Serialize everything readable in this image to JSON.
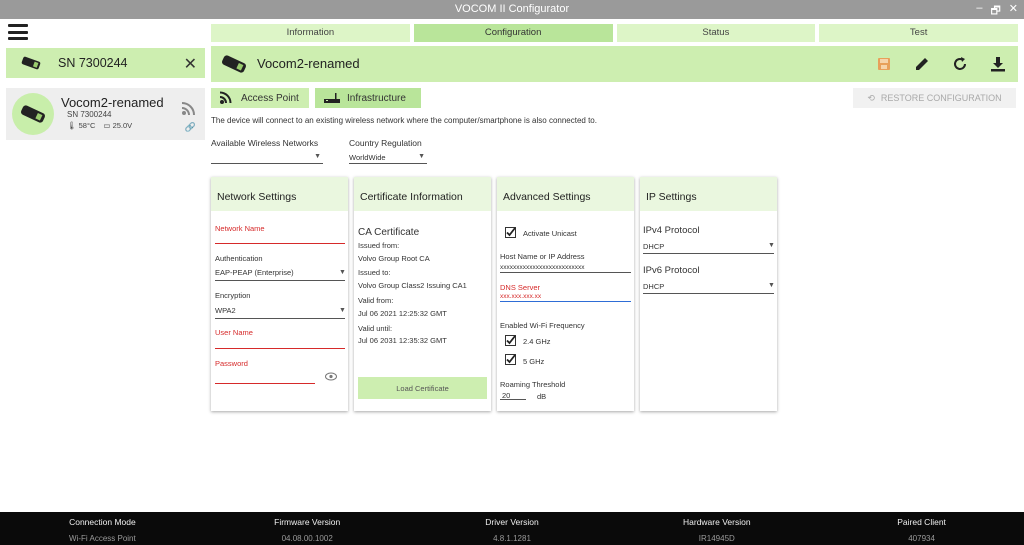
{
  "window": {
    "title": "VOCOM II Configurator",
    "controls": [
      "–",
      "🗗",
      "✕"
    ]
  },
  "sidebar": {
    "header_serial": "SN 7300244",
    "card": {
      "name": "Vocom2-renamed",
      "serial": "SN 7300244",
      "temp": "58°C",
      "voltage": "25.0V"
    }
  },
  "tabs": [
    {
      "label": "Information",
      "active": false
    },
    {
      "label": "Configuration",
      "active": true
    },
    {
      "label": "Status",
      "active": false
    },
    {
      "label": "Test",
      "active": false
    }
  ],
  "device_bar": {
    "name": "Vocom2-renamed"
  },
  "modes": {
    "access_point": "Access Point",
    "infrastructure": "Infrastructure",
    "restore": "RESTORE CONFIGURATION"
  },
  "description": "The device will connect to an existing wireless network where the computer/smartphone is also connected to.",
  "wireless": {
    "label": "Available Wireless Networks",
    "value": ""
  },
  "country": {
    "label": "Country Regulation",
    "value": "WorldWide"
  },
  "network_settings": {
    "title": "Network Settings",
    "network_name_label": "Network Name",
    "network_name_value": "",
    "auth_label": "Authentication",
    "auth_value": "EAP-PEAP (Enterprise)",
    "encryption_label": "Encryption",
    "encryption_value": "WPA2",
    "user_label": "User Name",
    "user_value": "",
    "password_label": "Password",
    "password_value": ""
  },
  "certificate": {
    "title": "Certificate Information",
    "ca_title": "CA Certificate",
    "issued_from_label": "Issued from:",
    "issued_from": "Volvo Group Root CA",
    "issued_to_label": "Issued to:",
    "issued_to": "Volvo Group Class2 Issuing CA1",
    "valid_from_label": "Valid from:",
    "valid_from": "Jul 06 2021 12:25:32 GMT",
    "valid_until_label": "Valid until:",
    "valid_until": "Jul 06 2031 12:35:32 GMT",
    "load_button": "Load Certificate"
  },
  "advanced": {
    "title": "Advanced Settings",
    "unicast_label": "Activate Unicast",
    "unicast_checked": true,
    "host_label": "Host Name or IP Address",
    "host_value": "xxxxxxxxxxxxxxxxxxxxxxxxxx",
    "dns_label": "DNS Server",
    "dns_value": "xxx.xxx.xxx.xx",
    "freq_label": "Enabled Wi-Fi Frequency",
    "freq_24": "2.4 GHz",
    "freq_5": "5 GHz",
    "roaming_label": "Roaming Threshold",
    "roaming_value": "20",
    "roaming_unit": "dB"
  },
  "ip": {
    "title": "IP Settings",
    "ipv4_label": "IPv4 Protocol",
    "ipv4_value": "DHCP",
    "ipv6_label": "IPv6 Protocol",
    "ipv6_value": "DHCP"
  },
  "footer": [
    {
      "head": "Connection Mode",
      "value": "Wi-Fi Access Point"
    },
    {
      "head": "Firmware Version",
      "value": "04.08.00.1002"
    },
    {
      "head": "Driver Version",
      "value": "4.8.1.1281"
    },
    {
      "head": "Hardware Version",
      "value": "IR14945D"
    },
    {
      "head": "Paired Client",
      "value": "407934"
    }
  ],
  "colors": {
    "accent": "#cdeeb0",
    "accent_dark": "#b9e59a",
    "error": "#d62a2a",
    "focus": "#2e6dd6"
  }
}
